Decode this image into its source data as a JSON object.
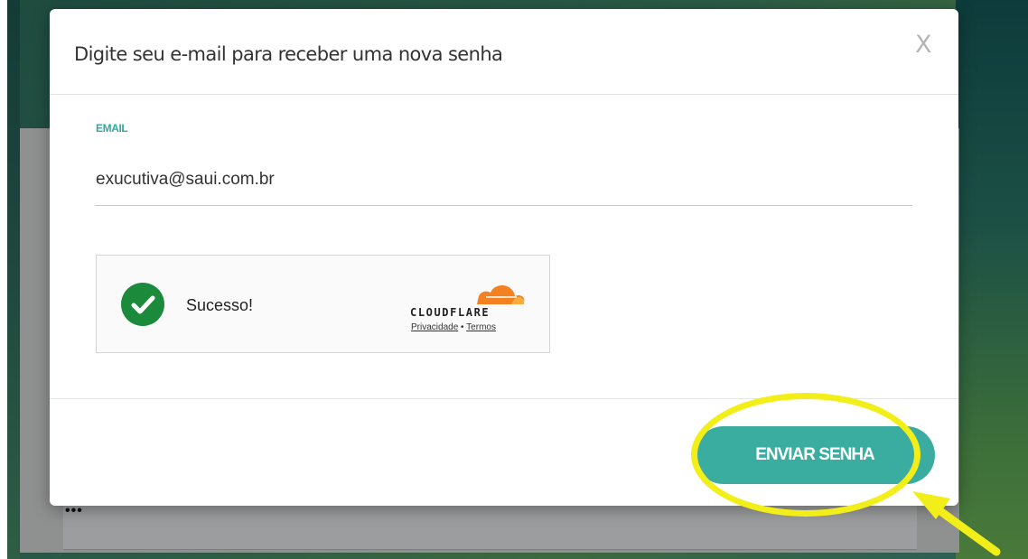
{
  "modal": {
    "title": "Digite seu e-mail para receber uma nova senha",
    "close_label": "X"
  },
  "form": {
    "email_label": "EMAIL",
    "email_value": "exucutiva@saui.com.br"
  },
  "captcha": {
    "status_text": "Sucesso!",
    "provider": "CLOUDFLARE",
    "privacy_link": "Privacidade",
    "separator": "•",
    "terms_link": "Termos"
  },
  "footer": {
    "submit_label": "ENVIAR SENHA"
  },
  "background": {
    "password_dots": "•••"
  },
  "colors": {
    "accent": "#3aada0",
    "success": "#1b8a3a",
    "cloudflare_orange": "#f48120",
    "annotation": "#f2ee1a"
  },
  "icons": {
    "success": "check-circle-icon",
    "provider_logo": "cloudflare-cloud-icon",
    "annotation": "arrow-icon"
  }
}
